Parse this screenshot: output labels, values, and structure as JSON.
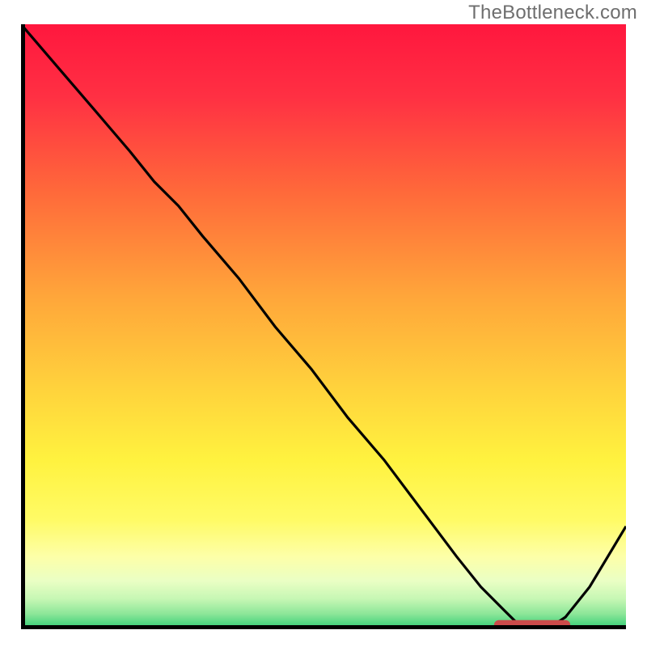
{
  "watermark": "TheBottleneck.com",
  "chart_data": {
    "type": "line",
    "title": "",
    "xlabel": "",
    "ylabel": "",
    "xlim": [
      0,
      100
    ],
    "ylim": [
      0,
      100
    ],
    "categories_note": "no axis ticks or labels are shown; x and y are normalized 0–100 from the plot frame",
    "series": [
      {
        "name": "curve",
        "color": "#000000",
        "x": [
          0,
          6,
          12,
          18,
          22,
          26,
          30,
          36,
          42,
          48,
          54,
          60,
          66,
          72,
          76,
          80,
          82,
          84,
          87,
          90,
          94,
          100
        ],
        "y": [
          100,
          93,
          86,
          79,
          74,
          70,
          65,
          58,
          50,
          43,
          35,
          28,
          20,
          12,
          7,
          3,
          1,
          0,
          0,
          2,
          7,
          17
        ]
      },
      {
        "name": "optimum-marker",
        "type": "segment",
        "color": "#cc4b4b",
        "x": [
          79,
          90
        ],
        "y": [
          0.7,
          0.7
        ],
        "stroke_width": 12,
        "linecap": "round"
      }
    ],
    "background_gradient": {
      "stops": [
        {
          "offset": 0.0,
          "color": "#ff173e"
        },
        {
          "offset": 0.12,
          "color": "#ff3043"
        },
        {
          "offset": 0.28,
          "color": "#ff6a3a"
        },
        {
          "offset": 0.45,
          "color": "#ffa63a"
        },
        {
          "offset": 0.6,
          "color": "#ffd23c"
        },
        {
          "offset": 0.72,
          "color": "#fff23f"
        },
        {
          "offset": 0.82,
          "color": "#fffb66"
        },
        {
          "offset": 0.88,
          "color": "#fdffa8"
        },
        {
          "offset": 0.92,
          "color": "#eaffc4"
        },
        {
          "offset": 0.95,
          "color": "#c6f7b4"
        },
        {
          "offset": 0.975,
          "color": "#8be698"
        },
        {
          "offset": 1.0,
          "color": "#2ecb74"
        }
      ]
    }
  }
}
